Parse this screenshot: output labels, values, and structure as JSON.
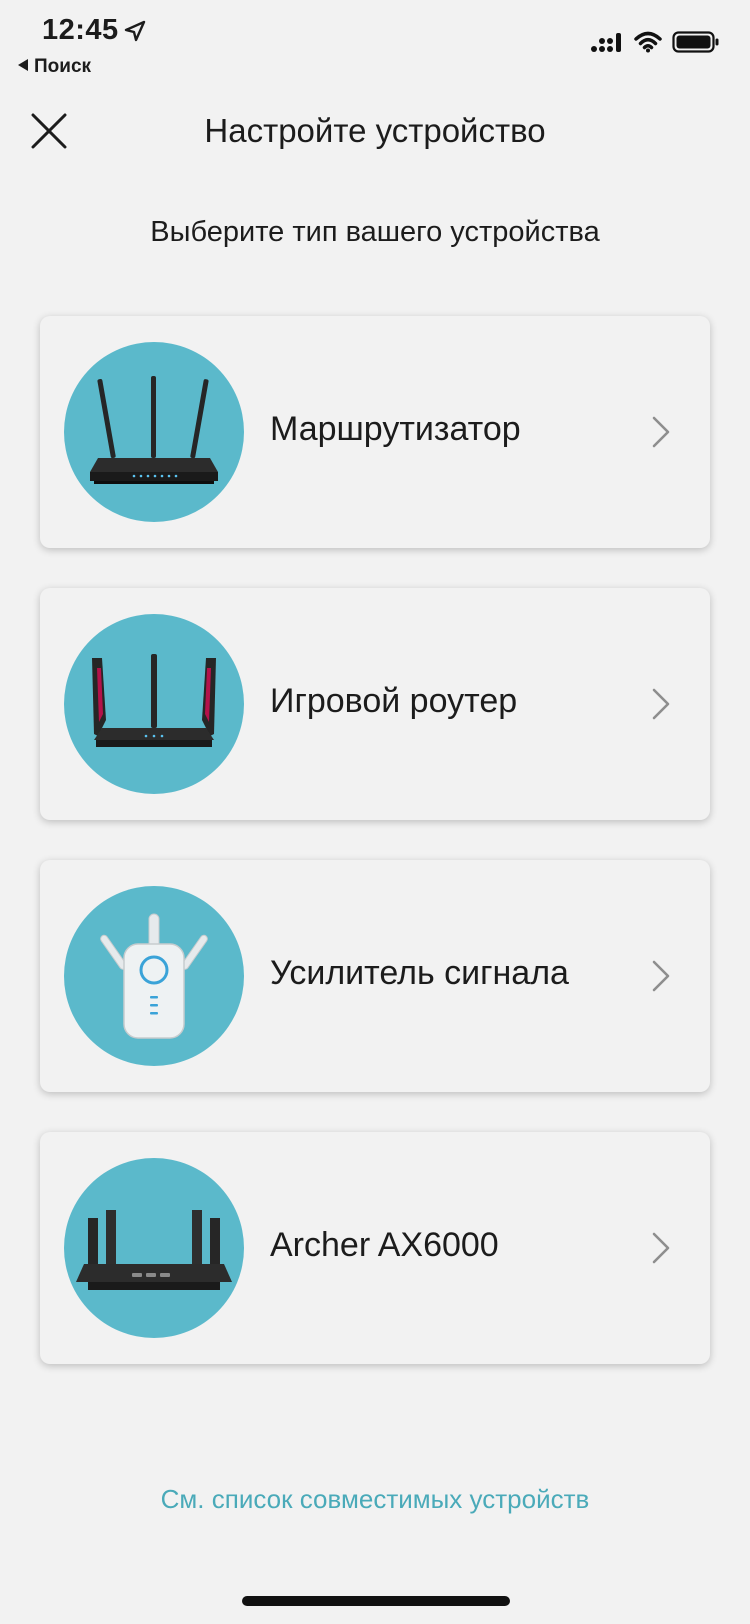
{
  "status_bar": {
    "time": "12:45",
    "back_app": "Поиск"
  },
  "header": {
    "title": "Настройте устройство"
  },
  "subtitle": "Выберите тип вашего устройства",
  "devices": [
    {
      "label": "Маршрутизатор",
      "icon": "router-icon"
    },
    {
      "label": "Игровой роутер",
      "icon": "gaming-router-icon"
    },
    {
      "label": "Усилитель сигнала",
      "icon": "range-extender-icon"
    },
    {
      "label": "Archer AX6000",
      "icon": "archer-ax6000-icon"
    }
  ],
  "footer": {
    "link": "См. список совместимых устройств"
  },
  "colors": {
    "accent": "#4aaab9",
    "circle": "#5bb9cb",
    "background": "#f2f2f2"
  }
}
